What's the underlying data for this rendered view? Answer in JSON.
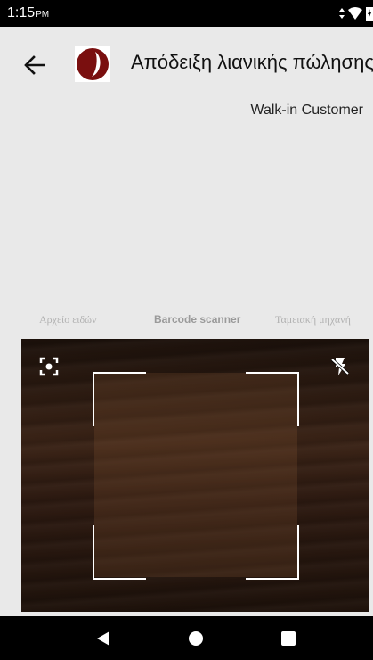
{
  "status_bar": {
    "time": "1:15",
    "ampm": "PM"
  },
  "header": {
    "title": "Απόδειξη λιανικής πώλησης",
    "customer": "Walk-in Customer",
    "icons": {
      "back": "arrow-left-icon",
      "logo": "app-logo"
    }
  },
  "tabs": [
    {
      "label": "Αρχείο ειδών",
      "active": false
    },
    {
      "label": "Barcode scanner",
      "active": true
    },
    {
      "label": "Ταμειακή μηχανή",
      "active": false
    }
  ],
  "scanner": {
    "icons": {
      "focus": "focus-icon",
      "flash": "flash-off-icon"
    }
  },
  "nav": {
    "icons": [
      "back-triangle-icon",
      "home-circle-icon",
      "recents-square-icon"
    ]
  },
  "colors": {
    "background": "#e9e9e9",
    "logo": "#7a0f0f",
    "bars": "#000000"
  }
}
